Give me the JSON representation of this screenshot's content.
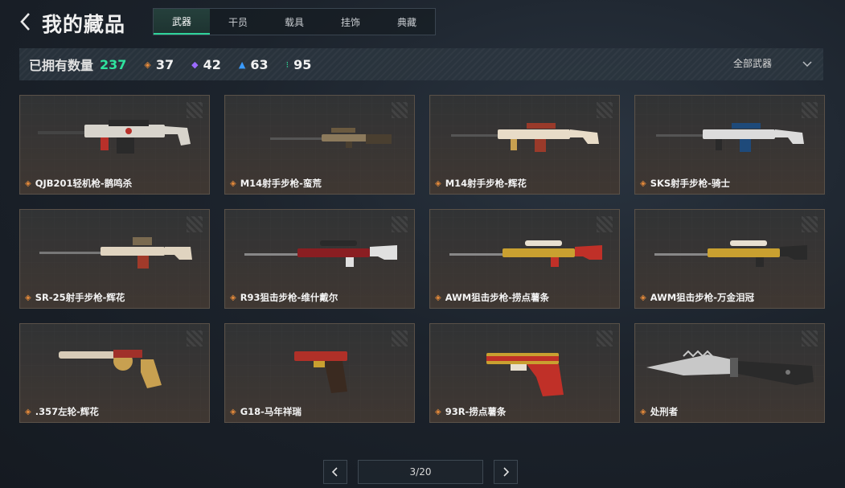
{
  "header": {
    "back_icon": "chevron-left-icon",
    "title": "我的藏品",
    "tabs": [
      {
        "label": "武器",
        "active": true
      },
      {
        "label": "干员",
        "active": false
      },
      {
        "label": "载具",
        "active": false
      },
      {
        "label": "挂饰",
        "active": false
      },
      {
        "label": "典藏",
        "active": false
      }
    ]
  },
  "stats": {
    "owned_label": "已拥有数量",
    "owned_count": "237",
    "rarities": [
      {
        "icon": "orange-gem-icon",
        "color": "#e58a3a",
        "count": "37"
      },
      {
        "icon": "purple-gem-icon",
        "color": "#9b6bff",
        "count": "42"
      },
      {
        "icon": "blue-gem-icon",
        "color": "#3a9bff",
        "count": "63"
      },
      {
        "icon": "green-gem-icon",
        "color": "#2fe39e",
        "count": "95"
      }
    ],
    "filter_label": "全部武器"
  },
  "items": [
    {
      "name": "QJB201轻机枪-鹊鸣杀",
      "type": "lmg",
      "colors": [
        "#d8d4cc",
        "#2a2a2a",
        "#b8302a"
      ]
    },
    {
      "name": "M14射手步枪-蛮荒",
      "type": "dmr-plain",
      "colors": [
        "#8c7a5c",
        "#4a3f30",
        "#6b5a40"
      ]
    },
    {
      "name": "M14射手步枪-辉花",
      "type": "dmr",
      "colors": [
        "#e8dcc8",
        "#9a3a2a",
        "#c8a050"
      ]
    },
    {
      "name": "SKS射手步枪-骑士",
      "type": "dmr",
      "colors": [
        "#dcdcdc",
        "#1e4a7a",
        "#2a2a2a"
      ]
    },
    {
      "name": "SR-25射手步枪-辉花",
      "type": "sniper-long",
      "colors": [
        "#e0d4c0",
        "#a03a2a",
        "#7a6a50"
      ]
    },
    {
      "name": "R93狙击步枪-维什戴尔",
      "type": "sniper",
      "colors": [
        "#8a1e22",
        "#e0e0e0",
        "#2a2a2a"
      ]
    },
    {
      "name": "AWM狙击步枪-捞点薯条",
      "type": "sniper",
      "colors": [
        "#c9a030",
        "#c03028",
        "#e8e0d0"
      ]
    },
    {
      "name": "AWM狙击步枪-万金泪冠",
      "type": "sniper",
      "colors": [
        "#c9a030",
        "#2a2a2a",
        "#e8e0d0"
      ]
    },
    {
      "name": ".357左轮-辉花",
      "type": "revolver",
      "colors": [
        "#d8ccb8",
        "#a0302a",
        "#c8a050"
      ]
    },
    {
      "name": "G18-马年祥瑞",
      "type": "pistol-small",
      "colors": [
        "#b03028",
        "#c9a030",
        "#3a2a20"
      ]
    },
    {
      "name": "93R-捞点薯条",
      "type": "pistol",
      "colors": [
        "#c03028",
        "#c9a030",
        "#e8e0d0"
      ]
    },
    {
      "name": "处刑者",
      "type": "knife",
      "colors": [
        "#c8c8c8",
        "#2a2a2a",
        "#5a5a5a"
      ]
    }
  ],
  "pagination": {
    "display": "3/20",
    "prev_icon": "chevron-left-icon",
    "next_icon": "chevron-right-icon"
  }
}
